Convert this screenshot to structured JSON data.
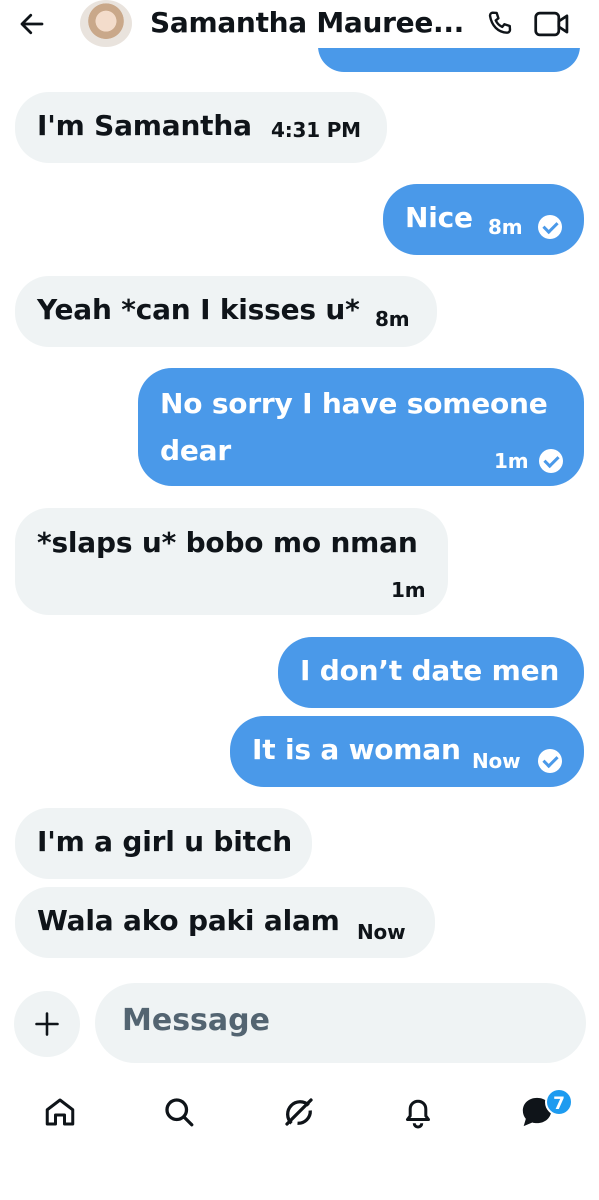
{
  "header": {
    "contact_name": "Samantha Mauree...",
    "icons": {
      "back": "back-arrow-icon",
      "call": "phone-icon",
      "video": "video-icon"
    }
  },
  "messages": [
    {
      "direction": "in",
      "text": "I'm Samantha",
      "time": "4:31 PM"
    },
    {
      "direction": "out",
      "text": "Nice",
      "time": "8m",
      "read": true
    },
    {
      "direction": "in",
      "text": "Yeah *can I kisses u*",
      "time": "8m"
    },
    {
      "direction": "out",
      "text_line1": "No sorry I have someone",
      "text_line2": "dear",
      "time": "1m",
      "read": true
    },
    {
      "direction": "in",
      "text": "*slaps u* bobo mo nman",
      "time": "1m"
    },
    {
      "direction": "out",
      "text": "I don’t date men"
    },
    {
      "direction": "out",
      "text": "It is a woman",
      "time": "Now",
      "read": true
    },
    {
      "direction": "in",
      "text": "I'm a girl u bitch"
    },
    {
      "direction": "in",
      "text": "Wala ako paki alam",
      "time": "Now"
    }
  ],
  "composer": {
    "placeholder": "Message",
    "add_icon": "plus-icon"
  },
  "tabbar": {
    "items": [
      "home-icon",
      "search-icon",
      "grok-icon",
      "notifications-icon",
      "messages-icon"
    ],
    "messages_badge": "7"
  },
  "colors": {
    "outgoing": "#4a99e9",
    "incoming": "#eff3f4",
    "badge": "#1d9bf0"
  }
}
